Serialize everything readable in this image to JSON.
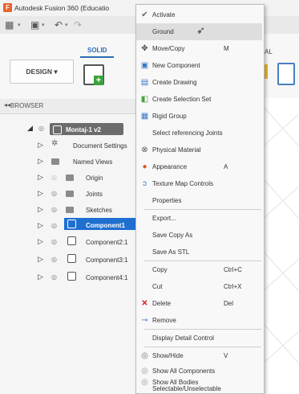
{
  "titlebar": {
    "title": "Autodesk Fusion 360 (Educatio",
    "logo": "F"
  },
  "ribbon": {
    "tab_solid": "SOLID",
    "design_label": "DESIGN ▾",
    "partial_tab": "AL"
  },
  "browser": {
    "title": "BROWSER",
    "collapse_icon": "◂◂",
    "root": {
      "label": "Montaj-1 v2"
    },
    "items": [
      {
        "label": "Document Settings",
        "icon": "gear-icon"
      },
      {
        "label": "Named Views",
        "icon": "folder-icon"
      },
      {
        "label": "Origin",
        "icon": "folder-icon"
      },
      {
        "label": "Joints",
        "icon": "folder-icon"
      },
      {
        "label": "Sketches",
        "icon": "folder-icon"
      },
      {
        "label": "Component1",
        "icon": "component-icon",
        "selected": true
      },
      {
        "label": "Component2:1",
        "icon": "component-icon"
      },
      {
        "label": "Component3:1",
        "icon": "component-icon"
      },
      {
        "label": "Component4:1",
        "icon": "component-icon"
      }
    ]
  },
  "menu": {
    "items": [
      {
        "label": "Activate",
        "icon": "check-circle-icon"
      },
      {
        "label": "Ground",
        "icon": "",
        "highlighted": true
      },
      {
        "label": "Move/Copy",
        "icon": "move-icon",
        "shortcut": "M"
      },
      {
        "label": "New Component",
        "icon": "new-component-icon"
      },
      {
        "label": "Create Drawing",
        "icon": "drawing-icon"
      },
      {
        "label": "Create Selection Set",
        "icon": "selection-set-icon"
      },
      {
        "label": "Rigid Group",
        "icon": "rigid-group-icon"
      },
      {
        "label": "Select referencing Joints",
        "icon": ""
      },
      {
        "label": "Physical Material",
        "icon": "material-icon"
      },
      {
        "label": "Appearance",
        "icon": "appearance-icon",
        "shortcut": "A"
      },
      {
        "label": "Texture Map Controls",
        "icon": "texture-icon"
      },
      {
        "label": "Properties",
        "icon": ""
      },
      {
        "label": "Export...",
        "icon": ""
      },
      {
        "label": "Save Copy As",
        "icon": ""
      },
      {
        "label": "Save As STL",
        "icon": ""
      },
      {
        "label": "Copy",
        "icon": "",
        "shortcut": "Ctrl+C"
      },
      {
        "label": "Cut",
        "icon": "",
        "shortcut": "Ctrl+X"
      },
      {
        "label": "Delete",
        "icon": "delete-icon",
        "shortcut": "Del"
      },
      {
        "label": "Remove",
        "icon": "remove-icon"
      },
      {
        "label": "Display Detail Control",
        "icon": ""
      },
      {
        "label": "Show/Hide",
        "icon": "eye-icon",
        "shortcut": "V"
      },
      {
        "label": "Show All Components",
        "icon": "eye-icon"
      },
      {
        "label": "Show All Bodies",
        "icon": "eye-icon"
      },
      {
        "label": "Selectable/Unselectable",
        "icon": ""
      }
    ]
  },
  "colors": {
    "accent": "#1f6fd0",
    "delete": "#d92020",
    "menu_bg": "#f8f8f8",
    "logo": "#e8632d"
  }
}
